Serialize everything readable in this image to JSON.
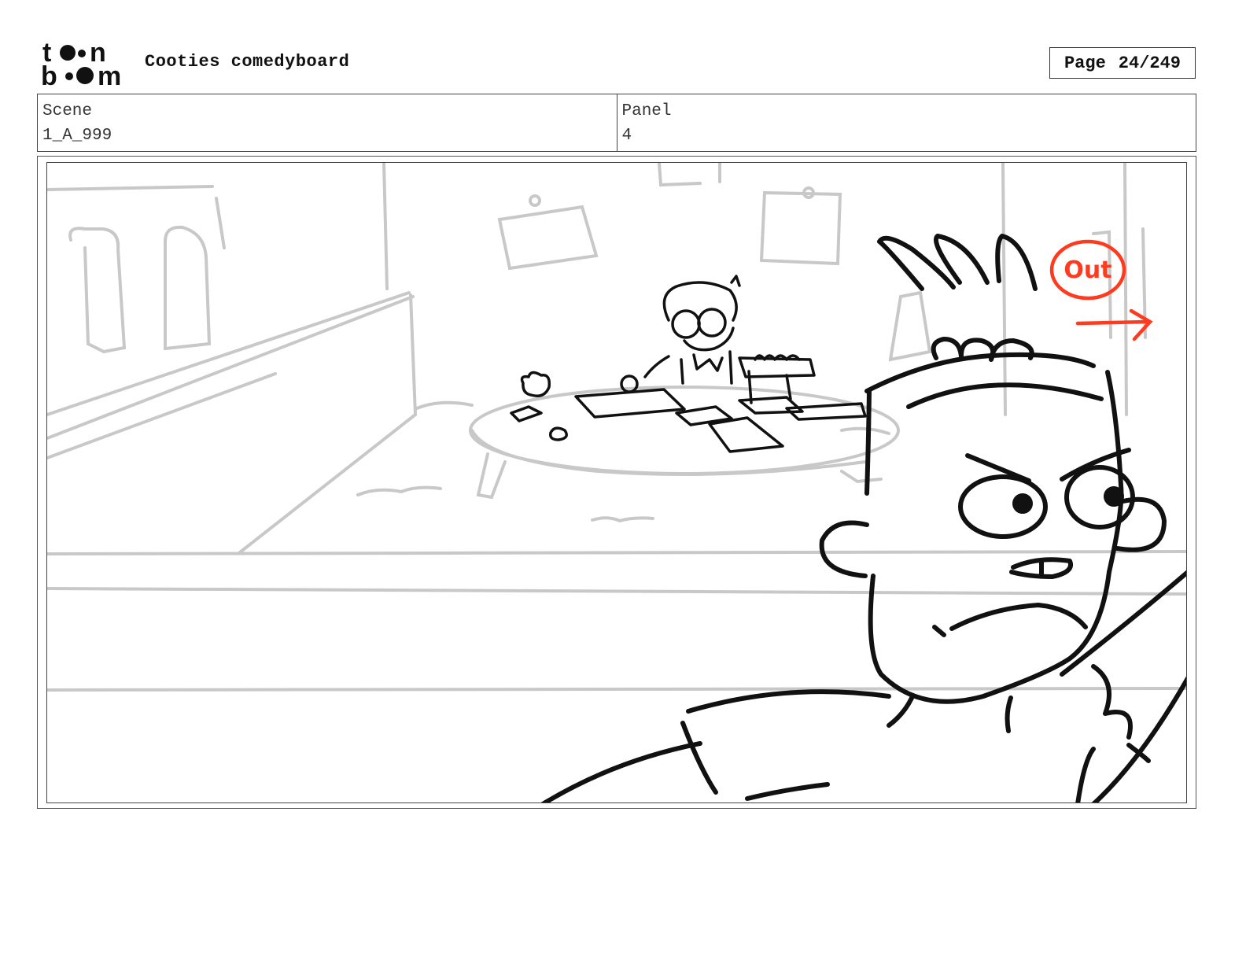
{
  "header": {
    "logo_text": "toon boom",
    "title": "Cooties comedyboard",
    "page_label": "Page",
    "page_value": "24/249"
  },
  "info": {
    "scene_label": "Scene",
    "scene_value": "1_A_999",
    "panel_label": "Panel",
    "panel_value": "4"
  },
  "annotation": {
    "text": "Out",
    "color": "#ff3b1f"
  },
  "colors": {
    "sketch_line": "#111111",
    "background_line": "#c8c8c8"
  }
}
